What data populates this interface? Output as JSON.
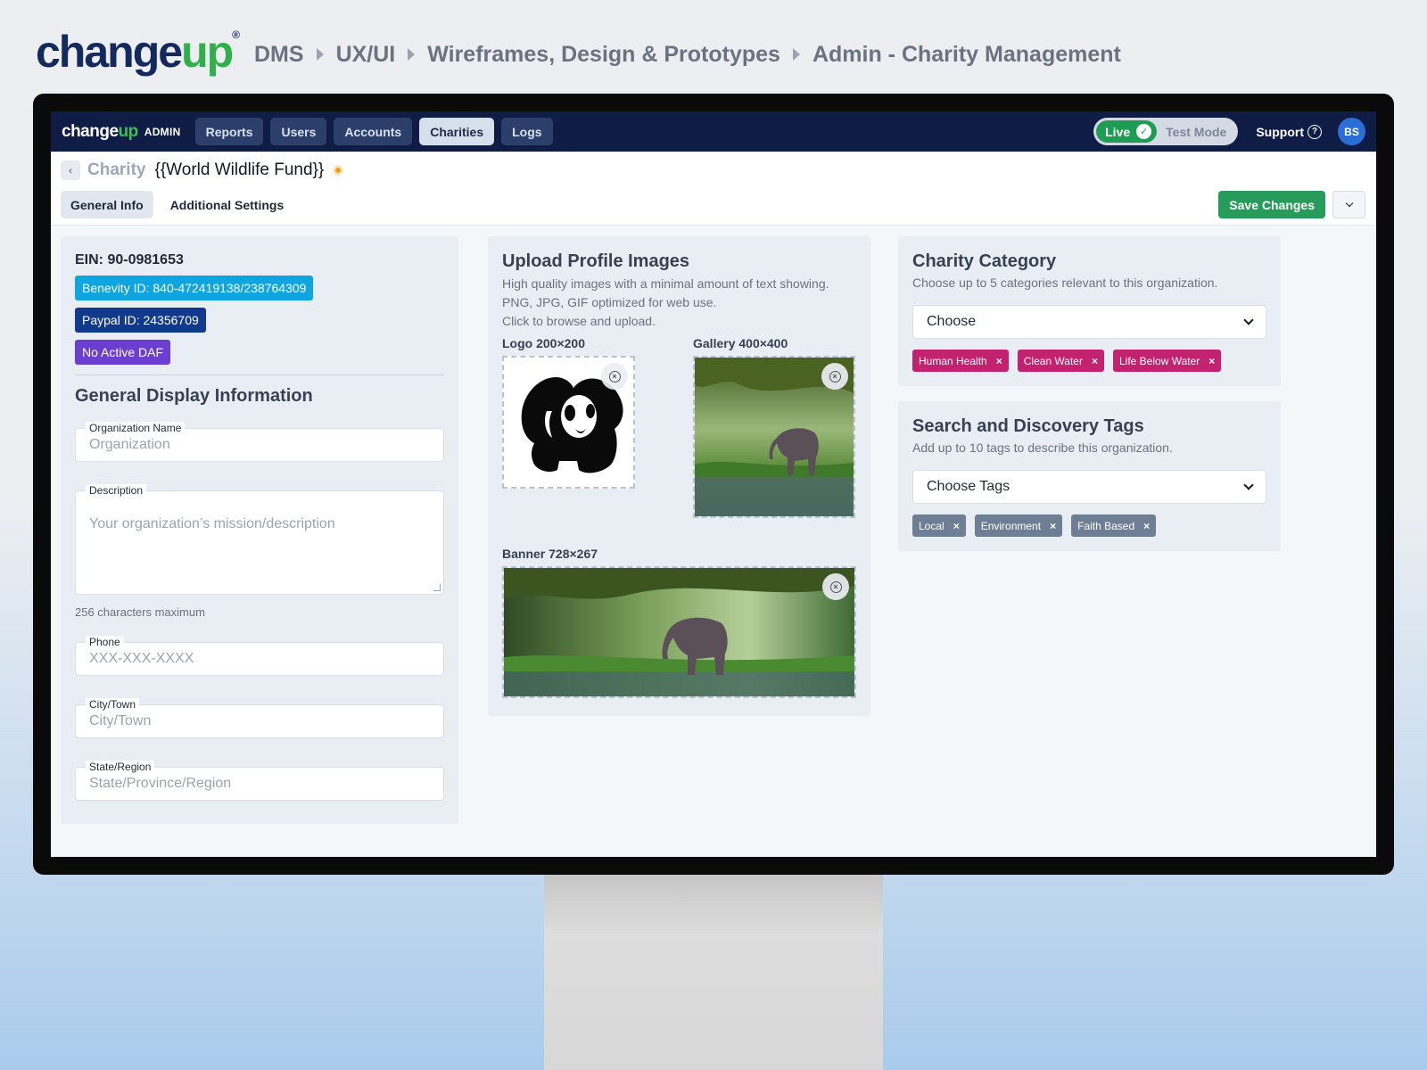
{
  "brand": {
    "logo_main": "change",
    "logo_accent": "up",
    "logo_mark": "®",
    "breadcrumb": [
      "DMS",
      "UX/UI",
      "Wireframes, Design & Prototypes",
      "Admin - Charity Management"
    ]
  },
  "app": {
    "logo_main": "change",
    "logo_accent": "up",
    "admin_label": "ADMIN",
    "nav": [
      "Reports",
      "Users",
      "Accounts",
      "Charities",
      "Logs"
    ],
    "active_nav": "Charities",
    "mode_live": "Live",
    "mode_test": "Test Mode",
    "support_label": "Support",
    "avatar_initials": "BS"
  },
  "header": {
    "title_kind": "Charity",
    "title_name": "{{World Wildlife Fund}}",
    "tabs": [
      "General Info",
      "Additional Settings"
    ],
    "save_label": "Save Changes"
  },
  "left": {
    "ein": "EIN: 90-0981653",
    "benevity": "Benevity ID:  840-472419138/238764309",
    "paypal": "Paypal ID:  24356709",
    "daf": "No Active DAF",
    "section_title": "General Display Information",
    "org_label": "Organization Name",
    "org_placeholder": "Organization",
    "desc_label": "Description",
    "desc_placeholder": "Your organization’s mission/description",
    "desc_help": "256 characters maximum",
    "phone_label": "Phone",
    "phone_placeholder": "XXX-XXX-XXXX",
    "city_label": "City/Town",
    "city_placeholder": "City/Town",
    "state_label": "State/Region",
    "state_placeholder": "State/Province/Region"
  },
  "images": {
    "title": "Upload Profile Images",
    "desc_lines": [
      "High quality images with a minimal amount of text showing.",
      "PNG, JPG, GIF optimized for web use.",
      "Click to browse and upload."
    ],
    "logo_label": "Logo 200×200",
    "gallery_label": "Gallery 400×400",
    "banner_label": "Banner 728×267"
  },
  "category": {
    "title": "Charity Category",
    "desc": "Choose up to 5 categories relevant to this organization.",
    "select_value": "Choose",
    "chips": [
      "Human Health",
      "Clean Water",
      "Life Below Water"
    ]
  },
  "tags": {
    "title": "Search and Discovery Tags",
    "desc": "Add up to 10 tags to describe this organization.",
    "select_value": "Choose Tags",
    "chips": [
      "Local",
      "Environment",
      "Faith Based"
    ]
  },
  "colors": {
    "navy": "#0f1d46",
    "brand_green": "#2fb04a",
    "save_green": "#279b59",
    "benevity_blue": "#0ea5e0",
    "paypal_navy": "#123a8a",
    "daf_purple": "#6d3fd1",
    "category_pink": "#c2226f",
    "tag_gray": "#6e7e94",
    "status_orange": "#f59e0b"
  }
}
